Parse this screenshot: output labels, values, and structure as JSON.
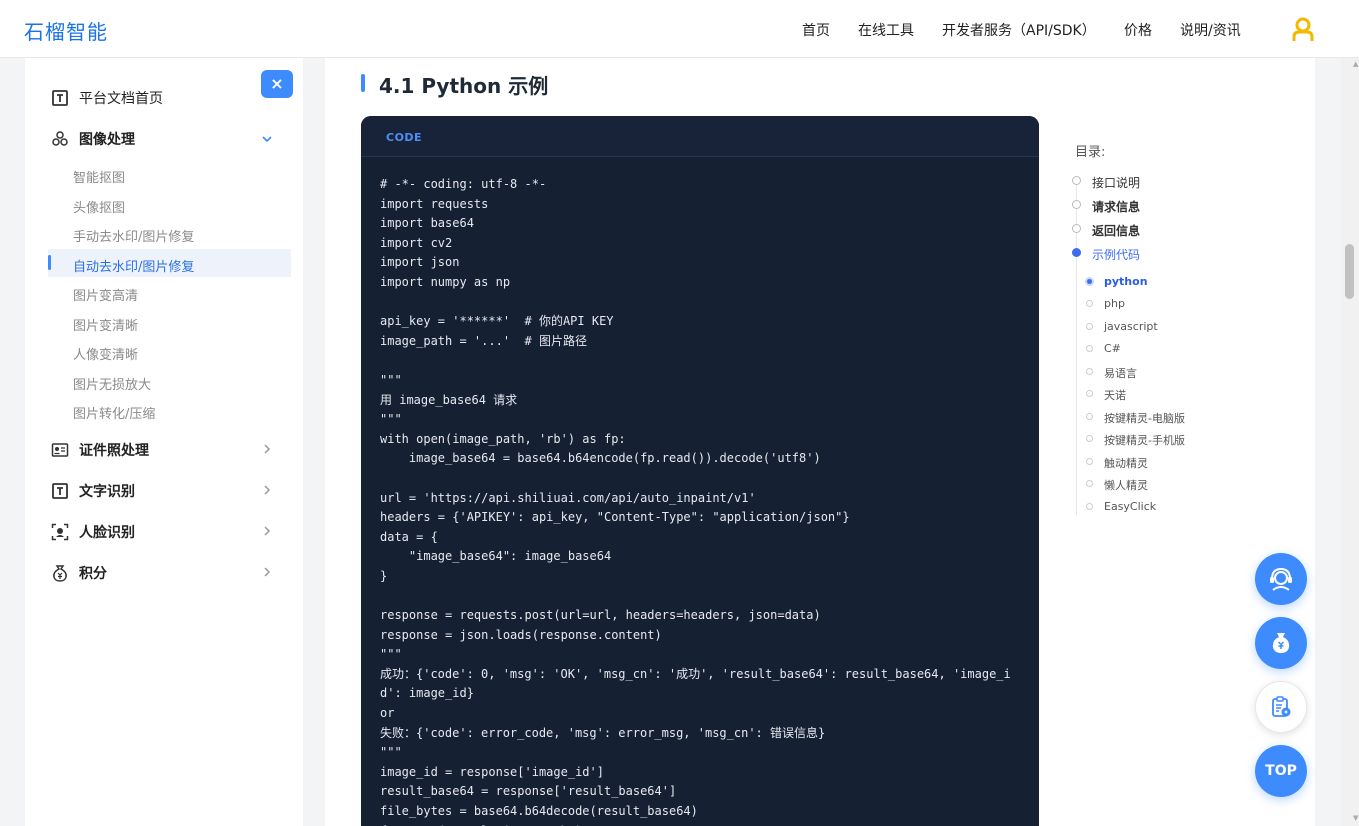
{
  "header": {
    "logo": "石榴智能",
    "nav": [
      "首页",
      "在线工具",
      "开发者服务（API/SDK）",
      "价格",
      "说明/资讯"
    ]
  },
  "sidebar": {
    "close": "×",
    "home": "平台文档首页",
    "image_processing": "图像处理",
    "sub_items": [
      "智能抠图",
      "头像抠图",
      "手动去水印/图片修复",
      "自动去水印/图片修复",
      "图片变高清",
      "图片变清晰",
      "人像变清晰",
      "图片无损放大",
      "图片转化/压缩"
    ],
    "active_sub_index": 3,
    "sections": [
      "证件照处理",
      "文字识别",
      "人脸识别",
      "积分"
    ]
  },
  "main": {
    "section_title": "4.1 Python 示例",
    "code_label": "CODE",
    "code": "# -*- coding: utf-8 -*-\nimport requests\nimport base64\nimport cv2\nimport json\nimport numpy as np\n\napi_key = '******'  # 你的API KEY\nimage_path = '...'  # 图片路径\n\n\"\"\"\n用 image_base64 请求\n\"\"\"\nwith open(image_path, 'rb') as fp:\n    image_base64 = base64.b64encode(fp.read()).decode('utf8')\n\nurl = 'https://api.shiliuai.com/api/auto_inpaint/v1'\nheaders = {'APIKEY': api_key, \"Content-Type\": \"application/json\"}\ndata = {\n    \"image_base64\": image_base64\n}\n\nresponse = requests.post(url=url, headers=headers, json=data)\nresponse = json.loads(response.content)\n\"\"\"\n成功：{'code': 0, 'msg': 'OK', 'msg_cn': '成功', 'result_base64': result_base64, 'image_i\nd': image_id}\nor\n失败：{'code': error_code, 'msg': error_msg, 'msg_cn': 错误信息}\n\"\"\"\nimage_id = response['image_id']\nresult_base64 = response['result_base64']\nfile_bytes = base64.b64decode(result_base64)\nf = open('result.jpg', 'wb')"
  },
  "toc": {
    "title": "目录:",
    "items": [
      "接口说明",
      "请求信息",
      "返回信息",
      "示例代码"
    ],
    "sub_items": [
      "python",
      "php",
      "javascript",
      "C#",
      "易语言",
      "天诺",
      "按键精灵-电脑版",
      "按键精灵-手机版",
      "触动精灵",
      "懒人精灵",
      "EasyClick"
    ]
  },
  "fabs": {
    "top": "TOP"
  },
  "colors": {
    "accent": "#3d8bfd",
    "code_bg": "#162033",
    "logo": "#1a73e8"
  }
}
